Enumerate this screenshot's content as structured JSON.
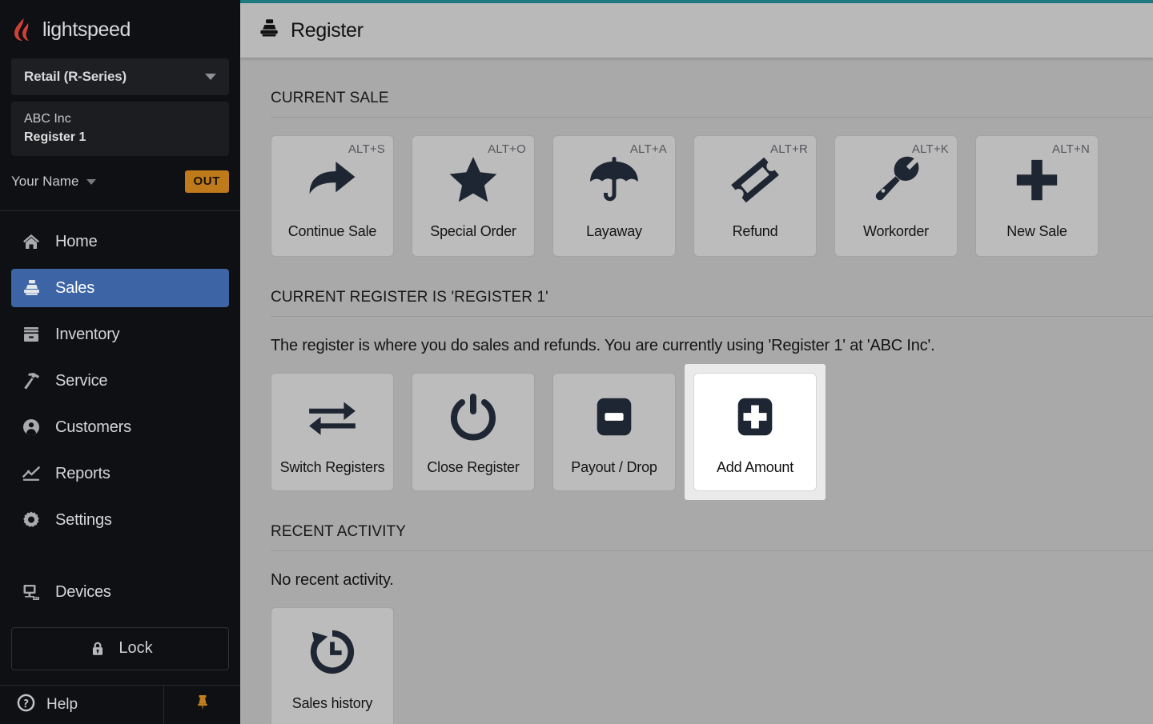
{
  "brand": {
    "name": "lightspeed",
    "logo_icon": "lightspeed-flame-icon"
  },
  "sidebar": {
    "product_select": {
      "label": "Retail (R-Series)",
      "caret_icon": "chevron-down-icon"
    },
    "store": {
      "name": "ABC Inc",
      "register": "Register 1"
    },
    "user": {
      "name": "Your Name",
      "caret_icon": "chevron-down-icon",
      "status_badge": "OUT"
    },
    "nav_items": [
      {
        "label": "Home",
        "icon": "home-icon",
        "active": false
      },
      {
        "label": "Sales",
        "icon": "register-icon",
        "active": true
      },
      {
        "label": "Inventory",
        "icon": "inventory-drawer-icon",
        "active": false
      },
      {
        "label": "Service",
        "icon": "hammer-icon",
        "active": false
      },
      {
        "label": "Customers",
        "icon": "user-circle-icon",
        "active": false
      },
      {
        "label": "Reports",
        "icon": "chart-line-icon",
        "active": false
      },
      {
        "label": "Settings",
        "icon": "gear-icon",
        "active": false
      },
      {
        "label": "Devices",
        "icon": "monitor-icon",
        "active": false
      }
    ],
    "lock_button": {
      "label": "Lock",
      "icon": "lock-icon"
    },
    "footer": {
      "help": {
        "label": "Help",
        "icon": "question-circle-icon"
      },
      "pin": {
        "icon": "pushpin-icon"
      }
    }
  },
  "header": {
    "title": "Register",
    "icon": "register-icon"
  },
  "main": {
    "current_sale": {
      "heading": "CURRENT SALE",
      "tiles": [
        {
          "label": "Continue Sale",
          "shortcut": "ALT+S",
          "icon": "arrow-curve-right-icon"
        },
        {
          "label": "Special Order",
          "shortcut": "ALT+O",
          "icon": "star-icon"
        },
        {
          "label": "Layaway",
          "shortcut": "ALT+A",
          "icon": "umbrella-icon"
        },
        {
          "label": "Refund",
          "shortcut": "ALT+R",
          "icon": "ticket-icon"
        },
        {
          "label": "Workorder",
          "shortcut": "ALT+K",
          "icon": "wrench-icon"
        },
        {
          "label": "New Sale",
          "shortcut": "ALT+N",
          "icon": "plus-icon"
        }
      ]
    },
    "current_register": {
      "heading": "CURRENT REGISTER IS 'REGISTER 1'",
      "description": "The register is where you do sales and refunds. You are currently using 'Register 1'  at 'ABC Inc'.",
      "tiles": [
        {
          "label": "Switch Registers",
          "icon": "arrows-swap-icon",
          "selected": false
        },
        {
          "label": "Close Register",
          "icon": "power-icon",
          "selected": false
        },
        {
          "label": "Payout / Drop",
          "icon": "minus-box-icon",
          "selected": false
        },
        {
          "label": "Add Amount",
          "icon": "plus-box-icon",
          "selected": true
        }
      ]
    },
    "recent_activity": {
      "heading": "RECENT ACTIVITY",
      "empty_text": "No recent activity.",
      "tiles": [
        {
          "label": "Sales history",
          "icon": "history-clock-icon"
        }
      ]
    }
  },
  "colors": {
    "accent_bar": "#1c7a80",
    "sidebar_bg": "#0e1013",
    "nav_active": "#3d65a5",
    "out_badge": "#bf7a1c",
    "pin": "#c07f20",
    "content_bg": "#a9a9a9",
    "tile_bg": "#bcbcbc",
    "icon_dark": "#1f2633"
  }
}
